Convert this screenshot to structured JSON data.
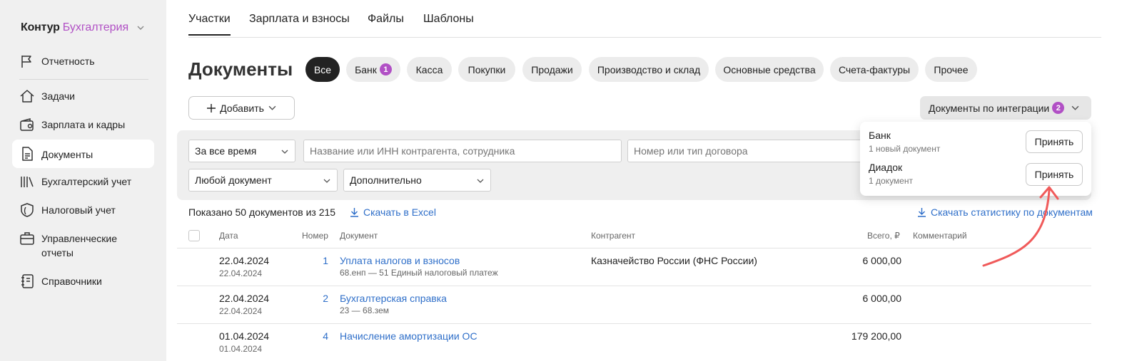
{
  "brand": {
    "part1": "Контур",
    "part2": "Бухгалтерия"
  },
  "sidebar": {
    "items": [
      {
        "label": "Отчетность",
        "icon": "flag-icon"
      },
      {
        "label": "Задачи",
        "icon": "house-icon"
      },
      {
        "label": "Зарплата и кадры",
        "icon": "wallet-icon"
      },
      {
        "label": "Документы",
        "icon": "document-icon"
      },
      {
        "label": "Бухгалтерский учет",
        "icon": "books-icon"
      },
      {
        "label": "Налоговый учет",
        "icon": "shield-icon"
      },
      {
        "label": "Управленческие отчеты",
        "icon": "briefcase-icon"
      },
      {
        "label": "Справочники",
        "icon": "notebook-icon"
      }
    ]
  },
  "tabs": [
    {
      "label": "Участки"
    },
    {
      "label": "Зарплата и взносы"
    },
    {
      "label": "Файлы"
    },
    {
      "label": "Шаблоны"
    }
  ],
  "page": {
    "title": "Документы"
  },
  "chips": [
    {
      "label": "Все"
    },
    {
      "label": "Банк",
      "badge": "1"
    },
    {
      "label": "Касса"
    },
    {
      "label": "Покупки"
    },
    {
      "label": "Продажи"
    },
    {
      "label": "Производство и склад"
    },
    {
      "label": "Основные средства"
    },
    {
      "label": "Счета-фактуры"
    },
    {
      "label": "Прочее"
    }
  ],
  "toolbar": {
    "add_label": "Добавить",
    "integration_label": "Документы по интеграции",
    "integration_badge": "2"
  },
  "filters": {
    "period": "За все время",
    "search_placeholder": "Название или ИНН контрагента, сотрудника",
    "contract_placeholder": "Номер или тип договора",
    "doc_type": "Любой документ",
    "extra": "Дополнительно"
  },
  "summary": {
    "text": "Показано 50 документов из 215",
    "excel_link": "Скачать в Excel",
    "stats_link": "Скачать статистику по документам"
  },
  "table": {
    "headers": {
      "date": "Дата",
      "number": "Номер",
      "document": "Документ",
      "counterparty": "Контрагент",
      "total": "Всего, ₽",
      "comment": "Комментарий"
    },
    "rows": [
      {
        "date": "22.04.2024",
        "date_sub": "22.04.2024",
        "number": "1",
        "document": "Уплата налогов и взносов",
        "document_sub": "68.енп — 51 Единый налоговый платеж",
        "counterparty": "Казначейство России (ФНС России)",
        "total": "6 000,00"
      },
      {
        "date": "22.04.2024",
        "date_sub": "22.04.2024",
        "number": "2",
        "document": "Бухгалтерская справка",
        "document_sub": "23 — 68.зем",
        "counterparty": "",
        "total": "6 000,00"
      },
      {
        "date": "01.04.2024",
        "date_sub": "01.04.2024",
        "number": "4",
        "document": "Начисление амортизации ОС",
        "document_sub": "",
        "counterparty": "",
        "total": "179 200,00"
      }
    ]
  },
  "popup": {
    "items": [
      {
        "title": "Банк",
        "subtitle": "1 новый документ",
        "button": "Принять"
      },
      {
        "title": "Диадок",
        "subtitle": "1 документ",
        "button": "Принять"
      }
    ]
  },
  "colors": {
    "accent": "#b150c5",
    "link": "#2f6fc9",
    "arrow": "#f05a5a"
  }
}
